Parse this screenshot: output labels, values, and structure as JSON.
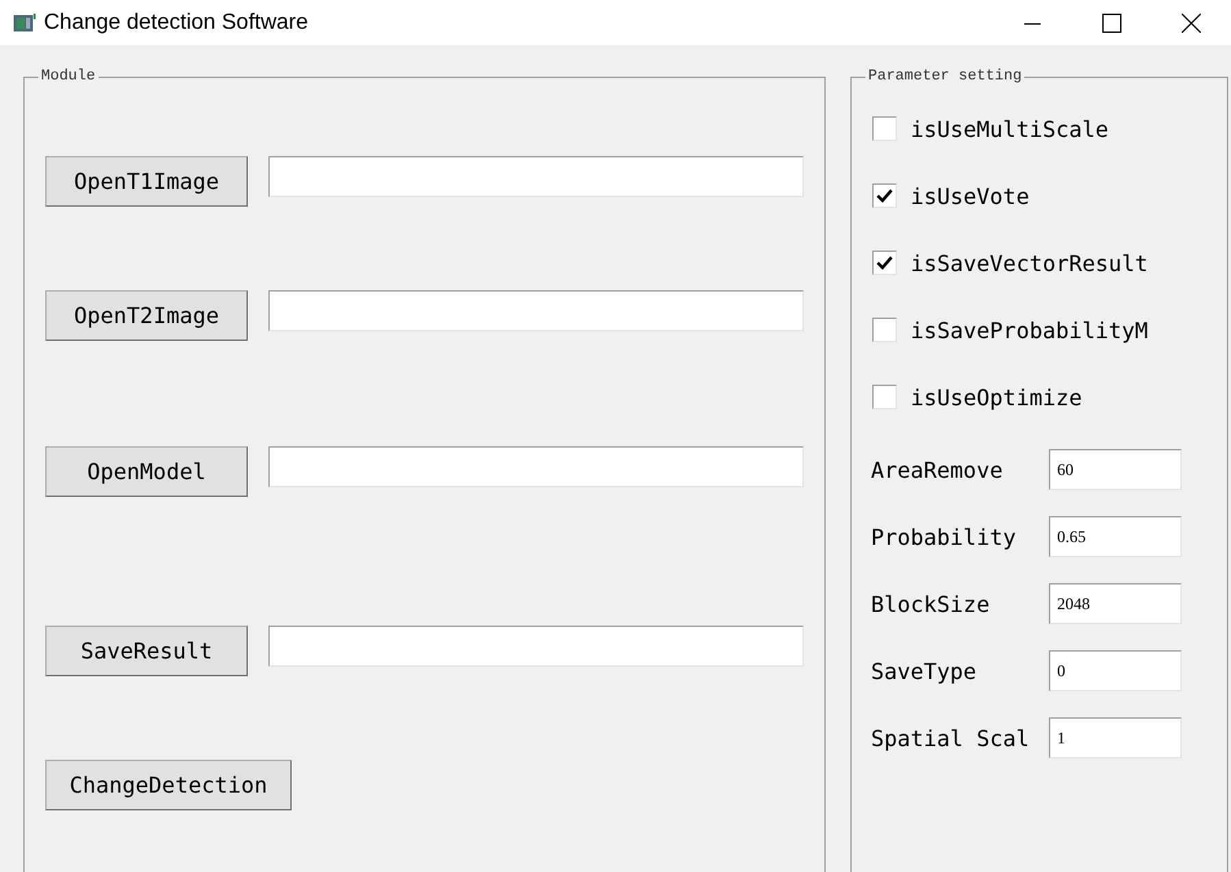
{
  "window": {
    "title": "Change detection Software"
  },
  "module": {
    "legend": "Module",
    "rows": [
      {
        "kind": "file",
        "button": "OpenT1Image"
      },
      {
        "kind": "file",
        "button": "OpenT2Image"
      },
      {
        "kind": "file",
        "button": "OpenModel"
      },
      {
        "kind": "file",
        "button": "SaveResult"
      },
      {
        "kind": "action",
        "button": "ChangeDetection"
      }
    ]
  },
  "parameters": {
    "legend": "Parameter setting",
    "checkboxes": [
      {
        "label": "isUseMultiScale",
        "checked": false
      },
      {
        "label": "isUseVote",
        "checked": true
      },
      {
        "label": "isSaveVectorResult",
        "checked": true
      },
      {
        "label": "isSaveProbabilityM",
        "checked": false
      },
      {
        "label": "isUseOptimize",
        "checked": false
      }
    ],
    "fields": [
      {
        "label": "AreaRemove",
        "value": "60"
      },
      {
        "label": "Probability",
        "value": "0.65"
      },
      {
        "label": "BlockSize",
        "value": "2048"
      },
      {
        "label": "SaveType",
        "value": "0"
      },
      {
        "label": "Spatial Scal",
        "value": "1"
      }
    ]
  }
}
